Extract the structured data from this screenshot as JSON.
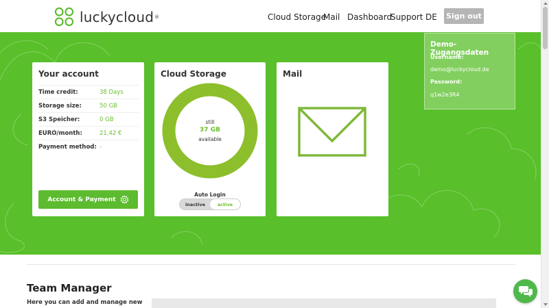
{
  "brand": {
    "name": "luckycloud",
    "reg": "®",
    "color": "#59bf2a"
  },
  "nav": {
    "items": [
      {
        "label": "Cloud Storage"
      },
      {
        "label": "Mail"
      },
      {
        "label": "Dashboard"
      },
      {
        "label": "Support"
      },
      {
        "label": "DE"
      }
    ],
    "signout_label": "Sign out"
  },
  "account": {
    "title": "Your account",
    "rows": [
      {
        "key": "Time credit:",
        "value": "38 Days"
      },
      {
        "key": "Storage size:",
        "value": "50 GB"
      },
      {
        "key": "S3 Speicher:",
        "value": "0 GB"
      },
      {
        "key": "EURO/month:",
        "value": "21,42 €"
      },
      {
        "key": "Payment method:",
        "value": "-"
      }
    ],
    "button_label": "Account & Payment"
  },
  "storage": {
    "title": "Cloud Storage",
    "still": "still",
    "amount": "37 GB",
    "available": "available",
    "free_fraction": 1.0,
    "auto_login_label": "Auto Login",
    "toggle_off": "inactive",
    "toggle_on": "active"
  },
  "mail": {
    "title": "Mail",
    "icon": "envelope-icon"
  },
  "demo": {
    "title": "Demo-Zugangsdaten",
    "username_label": "Username:",
    "username": "demo@luckycloud.de",
    "password_label": "Password:",
    "password": "q1w2e3R4"
  },
  "team": {
    "title": "Team Manager",
    "description": "Here you can add and manage new"
  }
}
